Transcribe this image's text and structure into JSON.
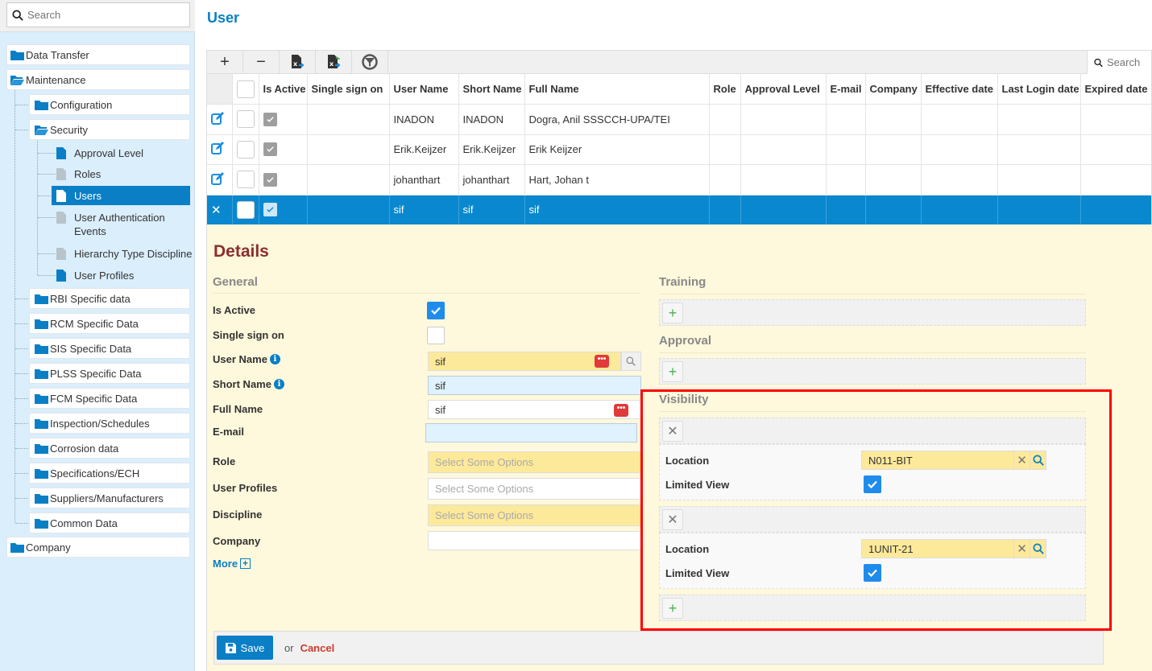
{
  "sidebar": {
    "search_placeholder": "Search",
    "tree": {
      "data_transfer": "Data Transfer",
      "maintenance": "Maintenance",
      "configuration": "Configuration",
      "security": "Security",
      "security_children": [
        "Approval Level",
        "Roles",
        "Users",
        "User Authentication Events",
        "Hierarchy Type Discipline",
        "User Profiles"
      ],
      "users_label": "Users",
      "uae_line1": "User Authentication",
      "uae_line2": "Events",
      "folders": [
        "RBI Specific data",
        "RCM Specific Data",
        "SIS Specific Data",
        "PLSS Specific Data",
        "FCM Specific Data",
        "Inspection/Schedules",
        "Corrosion data",
        "Specifications/ECH",
        "Suppliers/Manufacturers",
        "Common Data"
      ],
      "company": "Company",
      "selected": "Users"
    }
  },
  "page": {
    "title": "User"
  },
  "grid": {
    "toolbar": {
      "add": "+",
      "remove": "−",
      "search_placeholder": "Search"
    },
    "columns": [
      "Is Active",
      "Single sign on",
      "User Name",
      "Short Name",
      "Full Name",
      "Role",
      "Approval Level",
      "E-mail",
      "Company",
      "Effective date",
      "Last Login date",
      "Expired date"
    ],
    "rows": [
      {
        "is_active": true,
        "single_sign_on": "",
        "user_name": "INADON",
        "short_name": "INADON",
        "full_name": "Dogra, Anil SSSCCH-UPA/TEI",
        "role": "",
        "approval_level": "",
        "email": "",
        "company": "",
        "effective_date": "",
        "last_login_date": "",
        "expired_date": ""
      },
      {
        "is_active": true,
        "single_sign_on": "",
        "user_name": "Erik.Keijzer",
        "short_name": "Erik.Keijzer",
        "full_name": "Erik Keijzer",
        "role": "",
        "approval_level": "",
        "email": "",
        "company": "",
        "effective_date": "",
        "last_login_date": "",
        "expired_date": ""
      },
      {
        "is_active": true,
        "single_sign_on": "",
        "user_name": "johanthart",
        "short_name": "johanthart",
        "full_name": "Hart, Johan t",
        "role": "",
        "approval_level": "",
        "email": "",
        "company": "",
        "effective_date": "",
        "last_login_date": "",
        "expired_date": ""
      },
      {
        "is_active": true,
        "single_sign_on": "",
        "user_name": "sif",
        "short_name": "sif",
        "full_name": "sif",
        "role": "",
        "approval_level": "",
        "email": "",
        "company": "",
        "effective_date": "",
        "last_login_date": "",
        "expired_date": "",
        "selected": true
      }
    ]
  },
  "details": {
    "title": "Details",
    "general": {
      "title": "General",
      "is_active_label": "Is Active",
      "is_active": true,
      "sso_label": "Single sign on",
      "sso": false,
      "user_name_label": "User Name",
      "user_name": "sif",
      "short_name_label": "Short Name",
      "short_name": "sif",
      "full_name_label": "Full Name",
      "full_name": "sif",
      "email_label": "E-mail",
      "email": "",
      "role_label": "Role",
      "role_placeholder": "Select Some Options",
      "profiles_label": "User Profiles",
      "profiles_placeholder": "Select Some Options",
      "discipline_label": "Discipline",
      "discipline_placeholder": "Select Some Options",
      "company_label": "Company",
      "company": "",
      "more_label": "More"
    },
    "training": {
      "title": "Training"
    },
    "approval": {
      "title": "Approval"
    },
    "visibility": {
      "title": "Visibility",
      "entries": [
        {
          "location_label": "Location",
          "location": "N011-BIT",
          "limited_view_label": "Limited View",
          "limited_view": true
        },
        {
          "location_label": "Location",
          "location": "1UNIT-21",
          "limited_view_label": "Limited View",
          "limited_view": true
        }
      ]
    },
    "footer": {
      "save": "Save",
      "or": "or",
      "cancel": "Cancel"
    }
  },
  "colors": {
    "accent": "#0a7fc5",
    "highlight": "#ff0000",
    "details_bg": "#fef8dc",
    "title_red": "#8b2e2e"
  }
}
